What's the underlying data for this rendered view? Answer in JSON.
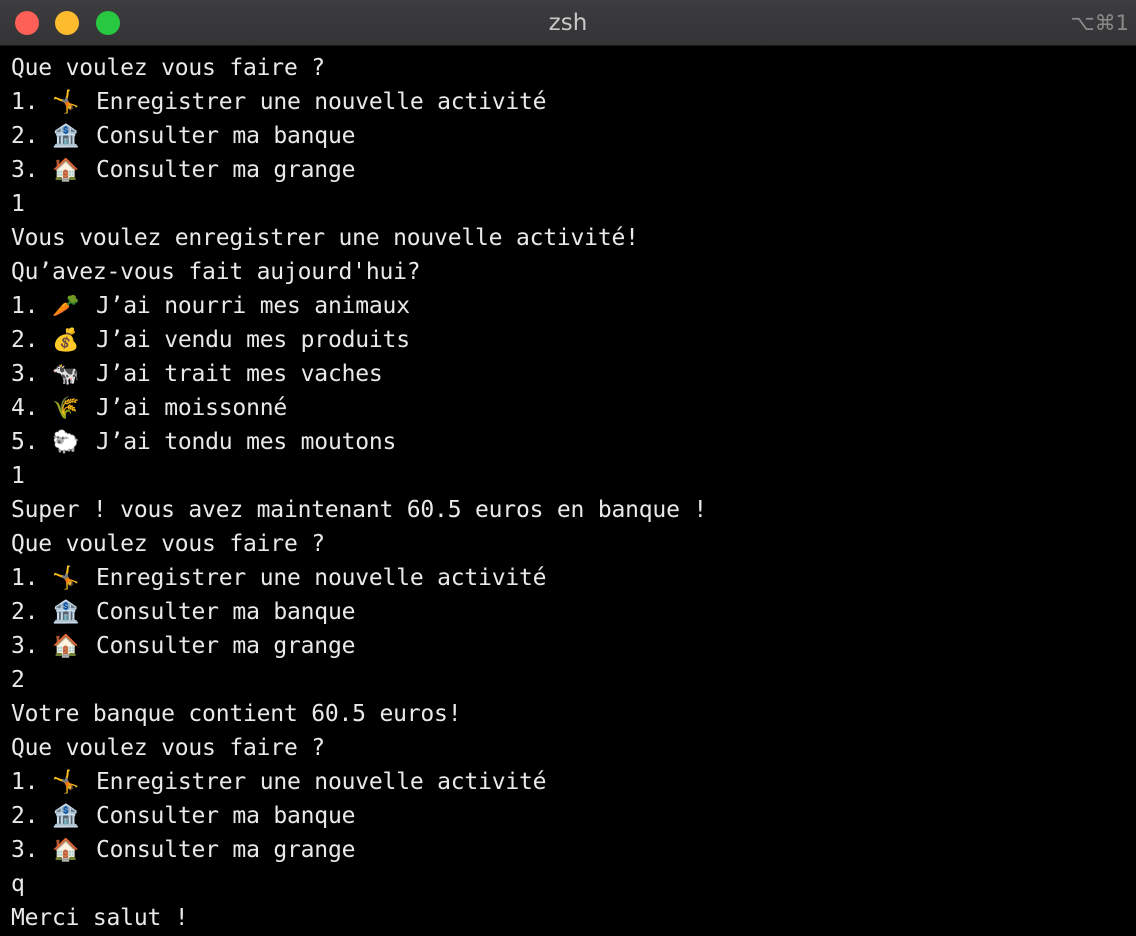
{
  "window": {
    "title": "zsh",
    "shortcut": "⌥⌘1"
  },
  "terminal": {
    "lines": [
      {
        "text": "Que voulez vous faire ?"
      },
      {
        "num": "1. ",
        "icon": "🤸",
        "label": "Enregistrer une nouvelle activité"
      },
      {
        "num": "2. ",
        "icon": "🏦",
        "label": "Consulter ma banque"
      },
      {
        "num": "3. ",
        "icon": "🏠",
        "label": "Consulter ma grange"
      },
      {
        "text": "1"
      },
      {
        "text": "Vous voulez enregistrer une nouvelle activité!"
      },
      {
        "text": "Qu’avez-vous fait aujourd'hui?"
      },
      {
        "num": "1. ",
        "icon": "🥕",
        "label": "J’ai nourri mes animaux"
      },
      {
        "num": "2. ",
        "icon": "💰",
        "label": "J’ai vendu mes produits"
      },
      {
        "num": "3. ",
        "icon": "🐄",
        "label": "J’ai trait mes vaches"
      },
      {
        "num": "4. ",
        "icon": "🌾",
        "label": "J’ai moissonné"
      },
      {
        "num": "5. ",
        "icon": "🐑",
        "label": "J’ai tondu mes moutons"
      },
      {
        "text": "1"
      },
      {
        "text": "Super ! vous avez maintenant 60.5 euros en banque !"
      },
      {
        "text": "Que voulez vous faire ?"
      },
      {
        "num": "1. ",
        "icon": "🤸",
        "label": "Enregistrer une nouvelle activité"
      },
      {
        "num": "2. ",
        "icon": "🏦",
        "label": "Consulter ma banque"
      },
      {
        "num": "3. ",
        "icon": "🏠",
        "label": "Consulter ma grange"
      },
      {
        "text": "2"
      },
      {
        "text": "Votre banque contient 60.5 euros!"
      },
      {
        "text": "Que voulez vous faire ?"
      },
      {
        "num": "1. ",
        "icon": "🤸",
        "label": "Enregistrer une nouvelle activité"
      },
      {
        "num": "2. ",
        "icon": "🏦",
        "label": "Consulter ma banque"
      },
      {
        "num": "3. ",
        "icon": "🏠",
        "label": "Consulter ma grange"
      },
      {
        "text": "q"
      },
      {
        "text": "Merci salut !"
      }
    ]
  }
}
